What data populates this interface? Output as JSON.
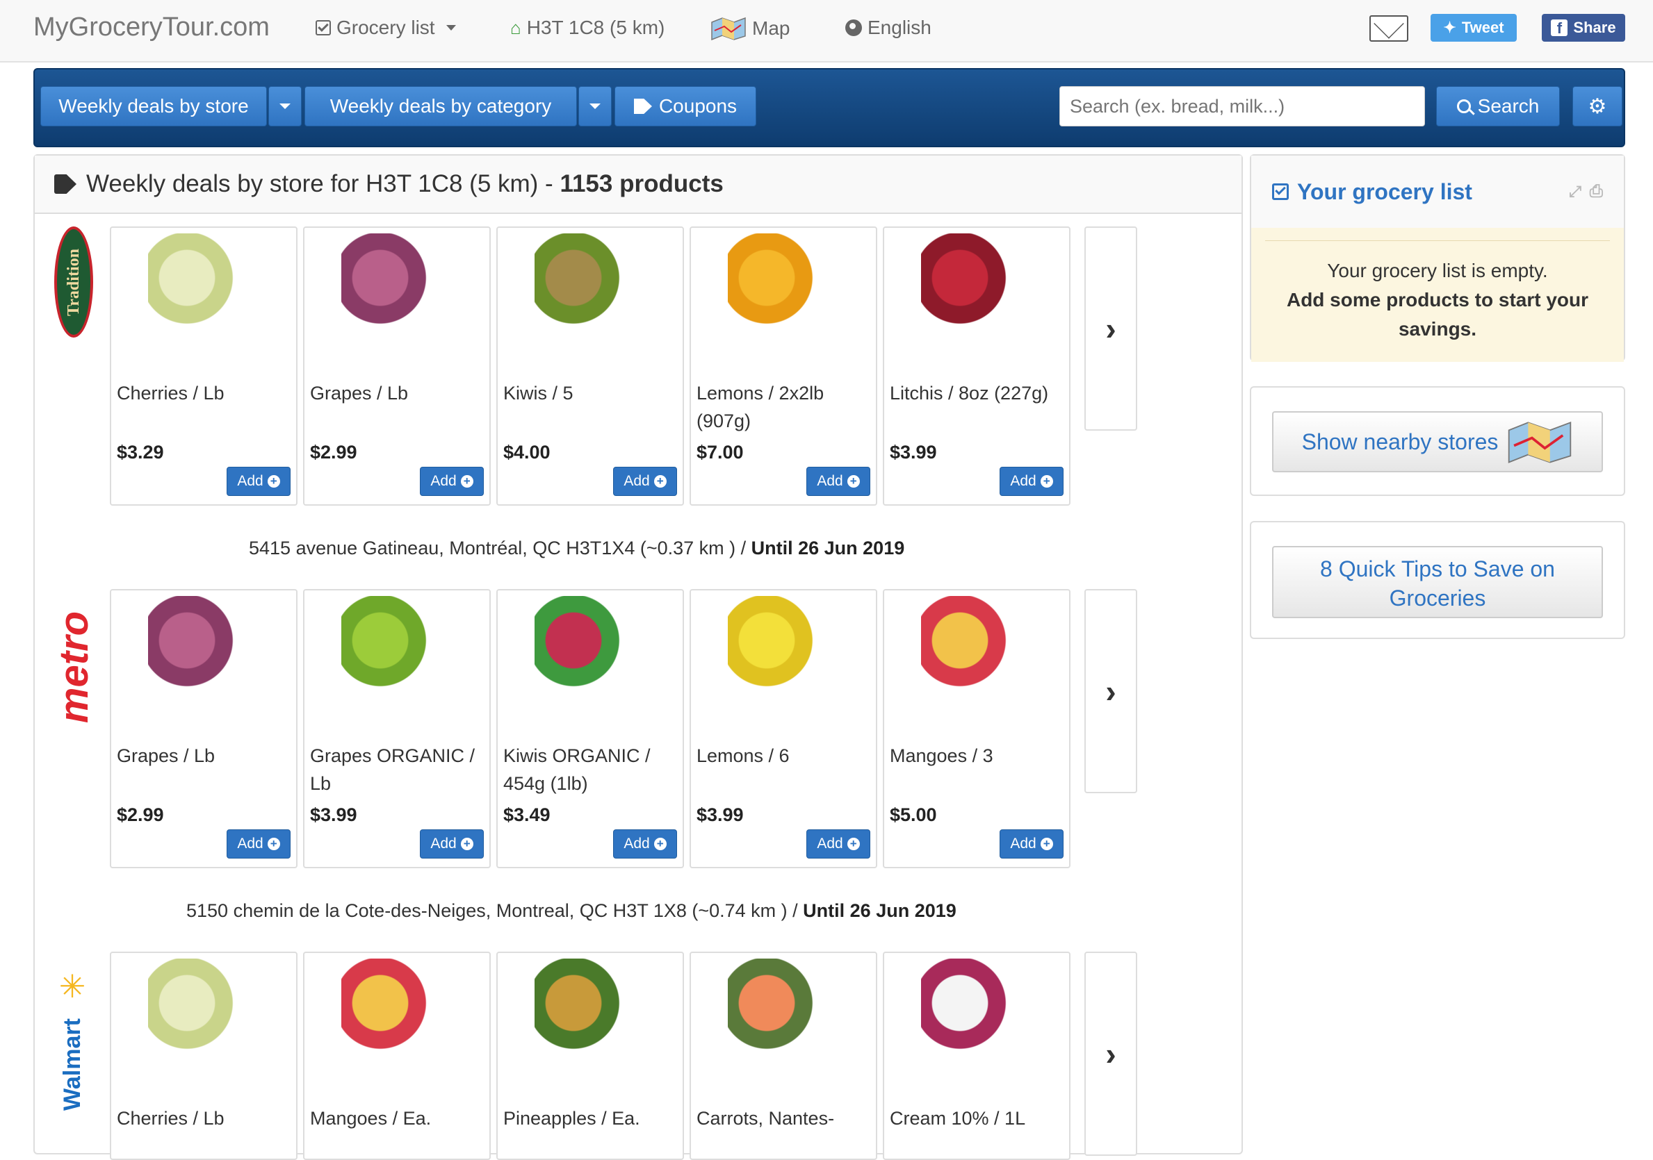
{
  "nav": {
    "brand": "MyGroceryTour.com",
    "grocery_list": "Grocery list",
    "location": "H3T 1C8 (5 km)",
    "map": "Map",
    "language": "English",
    "tweet": "Tweet",
    "share": "Share"
  },
  "toolbar": {
    "by_store": "Weekly deals by store",
    "by_category": "Weekly deals by category",
    "coupons": "Coupons",
    "search_placeholder": "Search (ex. bread, milk...)",
    "search_button": "Search"
  },
  "main": {
    "title_prefix": "Weekly deals by store for H3T 1C8 (5 km) - ",
    "title_count": "1153 products",
    "add_label": "Add"
  },
  "stores": [
    {
      "logo": "Tradition",
      "products": [
        {
          "name": "Cherries / Lb",
          "price": "$3.29"
        },
        {
          "name": "Grapes / Lb",
          "price": "$2.99"
        },
        {
          "name": "Kiwis / 5",
          "price": "$4.00"
        },
        {
          "name": "Lemons / 2x2lb (907g)",
          "price": "$7.00"
        },
        {
          "name": "Litchis / 8oz (227g)",
          "price": "$3.99"
        }
      ],
      "address": "5415 avenue Gatineau, Montréal, QC H3T1X4 (~0.37 km ) / ",
      "until": "Until 26 Jun 2019"
    },
    {
      "logo": "metro",
      "products": [
        {
          "name": "Grapes / Lb",
          "price": "$2.99"
        },
        {
          "name": "Grapes ORGANIC / Lb",
          "price": "$3.99"
        },
        {
          "name": "Kiwis ORGANIC / 454g (1lb)",
          "price": "$3.49"
        },
        {
          "name": "Lemons / 6",
          "price": "$3.99"
        },
        {
          "name": "Mangoes / 3",
          "price": "$5.00"
        }
      ],
      "address": "5150 chemin de la Cote-des-Neiges, Montreal, QC H3T 1X8 (~0.74 km ) / ",
      "until": "Until 26 Jun 2019"
    },
    {
      "logo": "Walmart",
      "products": [
        {
          "name": "Cherries / Lb"
        },
        {
          "name": "Mangoes / Ea."
        },
        {
          "name": "Pineapples / Ea."
        },
        {
          "name": "Carrots, Nantes-"
        },
        {
          "name": "Cream 10% / 1L"
        }
      ]
    }
  ],
  "sidebar": {
    "grocery_title": "Your grocery list",
    "empty_line1": "Your grocery list is empty.",
    "empty_line2": "Add some products to start your savings.",
    "nearby": "Show nearby stores",
    "tips": "8 Quick Tips to Save on Groceries"
  },
  "colors": {
    "primary": "#2f74c2",
    "toolbar": "#164a82",
    "empty_bg": "#fcf6e0"
  }
}
